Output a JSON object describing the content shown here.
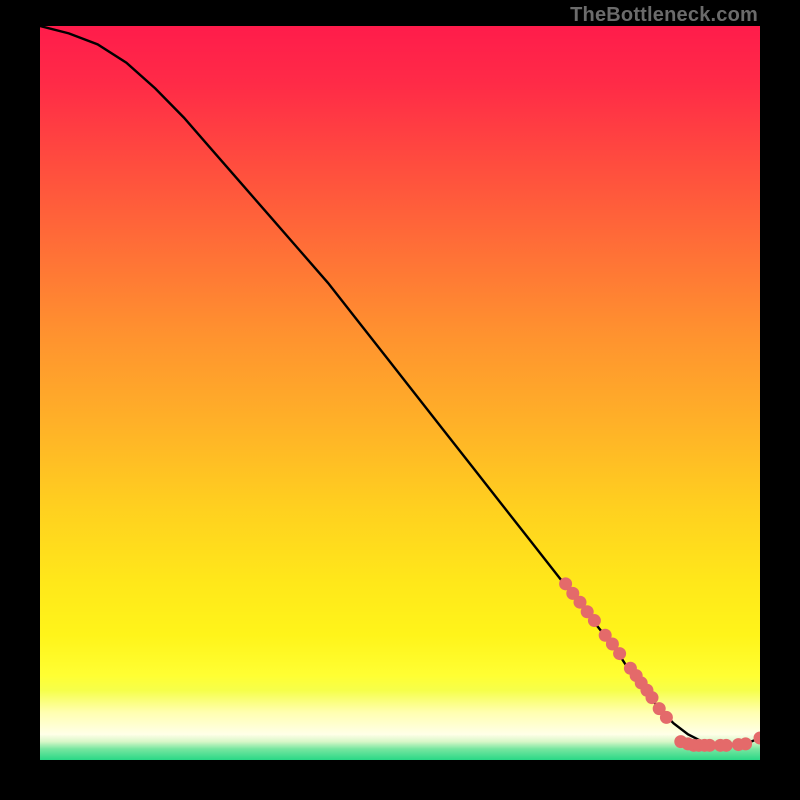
{
  "attribution": "TheBottleneck.com",
  "chart_data": {
    "type": "line",
    "title": "",
    "xlabel": "",
    "ylabel": "",
    "xlim": [
      0,
      100
    ],
    "ylim": [
      0,
      100
    ],
    "grid": false,
    "series": [
      {
        "name": "curve",
        "x": [
          0,
          4,
          8,
          12,
          16,
          20,
          24,
          28,
          32,
          36,
          40,
          44,
          48,
          52,
          56,
          60,
          64,
          68,
          72,
          76,
          80,
          82,
          84,
          86,
          88,
          90,
          92,
          94,
          96,
          98,
          100
        ],
        "y": [
          100,
          99,
          97.5,
          95,
          91.5,
          87.5,
          83,
          78.5,
          74,
          69.5,
          65,
          60,
          55,
          50,
          45,
          40,
          35,
          30,
          25,
          20,
          15,
          12,
          9.5,
          7,
          5,
          3.5,
          2.5,
          2,
          2,
          2.2,
          3
        ]
      }
    ],
    "highlight_points": [
      {
        "x": 73,
        "y": 24
      },
      {
        "x": 74,
        "y": 22.7
      },
      {
        "x": 75,
        "y": 21.5
      },
      {
        "x": 76,
        "y": 20.2
      },
      {
        "x": 77,
        "y": 19
      },
      {
        "x": 78.5,
        "y": 17
      },
      {
        "x": 79.5,
        "y": 15.8
      },
      {
        "x": 80.5,
        "y": 14.5
      },
      {
        "x": 82,
        "y": 12.5
      },
      {
        "x": 82.8,
        "y": 11.5
      },
      {
        "x": 83.5,
        "y": 10.5
      },
      {
        "x": 84.3,
        "y": 9.5
      },
      {
        "x": 85,
        "y": 8.5
      },
      {
        "x": 86,
        "y": 7
      },
      {
        "x": 87,
        "y": 5.8
      },
      {
        "x": 89,
        "y": 2.5
      },
      {
        "x": 90,
        "y": 2.2
      },
      {
        "x": 90.8,
        "y": 2
      },
      {
        "x": 91.5,
        "y": 2
      },
      {
        "x": 92.3,
        "y": 2
      },
      {
        "x": 93,
        "y": 2
      },
      {
        "x": 94.5,
        "y": 2
      },
      {
        "x": 95.3,
        "y": 2
      },
      {
        "x": 97,
        "y": 2.1
      },
      {
        "x": 98,
        "y": 2.2
      },
      {
        "x": 100,
        "y": 3
      }
    ],
    "gradient_stops": [
      {
        "pos": 0.0,
        "color": "#ff1c4b"
      },
      {
        "pos": 0.08,
        "color": "#ff2b47"
      },
      {
        "pos": 0.18,
        "color": "#ff4a3f"
      },
      {
        "pos": 0.3,
        "color": "#ff6e37"
      },
      {
        "pos": 0.42,
        "color": "#ff922f"
      },
      {
        "pos": 0.55,
        "color": "#ffb327"
      },
      {
        "pos": 0.66,
        "color": "#ffd11f"
      },
      {
        "pos": 0.76,
        "color": "#ffe81a"
      },
      {
        "pos": 0.83,
        "color": "#fff41a"
      },
      {
        "pos": 0.885,
        "color": "#ffff33"
      },
      {
        "pos": 0.905,
        "color": "#f6ff4a"
      },
      {
        "pos": 0.935,
        "color": "#ffffb0"
      },
      {
        "pos": 0.965,
        "color": "#ffffe8"
      },
      {
        "pos": 0.975,
        "color": "#d8f7c8"
      },
      {
        "pos": 0.985,
        "color": "#77e6a0"
      },
      {
        "pos": 1.0,
        "color": "#29d886"
      }
    ],
    "colors": {
      "curve": "#000000",
      "highlight": "#e46a6a",
      "background_frame": "#000000"
    }
  }
}
